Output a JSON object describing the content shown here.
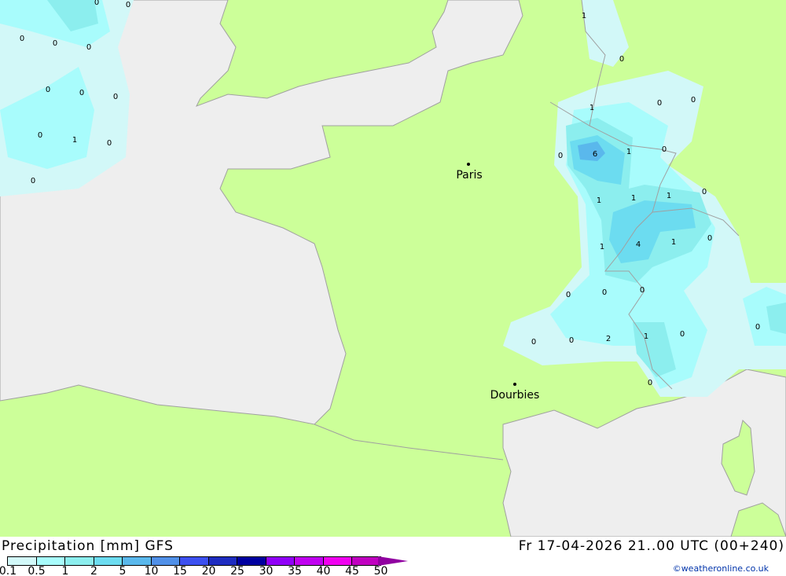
{
  "title": "Precipitation [mm] GFS",
  "datetime": "Fr 17-04-2026 21..00 UTC (00+240)",
  "credit": "©weatheronline.co.uk",
  "colors": {
    "land": "#ccff99",
    "sea": "#eeeeee",
    "border": "#a0a0a0"
  },
  "legend": {
    "ticks": [
      "0.1",
      "0.5",
      "1",
      "2",
      "5",
      "10",
      "15",
      "20",
      "25",
      "30",
      "35",
      "40",
      "45",
      "50"
    ],
    "colors": [
      "#d2f8f8",
      "#a8fcfc",
      "#8ceeee",
      "#6cdcf0",
      "#5ab8ec",
      "#5090e8",
      "#3c50f0",
      "#1e2cc0",
      "#0000a0",
      "#9000f8",
      "#c000f0",
      "#f000f0",
      "#c000c0"
    ]
  },
  "cities": [
    {
      "name": "Paris"
    },
    {
      "name": "Dourbies"
    }
  ],
  "map_labels": [
    "0",
    "0",
    "0",
    "0",
    "0",
    "0",
    "0",
    "0",
    "0",
    "1",
    "0",
    "0",
    "1",
    "0",
    "1",
    "0",
    "0",
    "6",
    "1",
    "0",
    "1",
    "1",
    "1",
    "0",
    "4",
    "1",
    "1",
    "0",
    "0",
    "0",
    "0",
    "0",
    "0",
    "0",
    "2",
    "1",
    "0",
    "0",
    "0"
  ]
}
